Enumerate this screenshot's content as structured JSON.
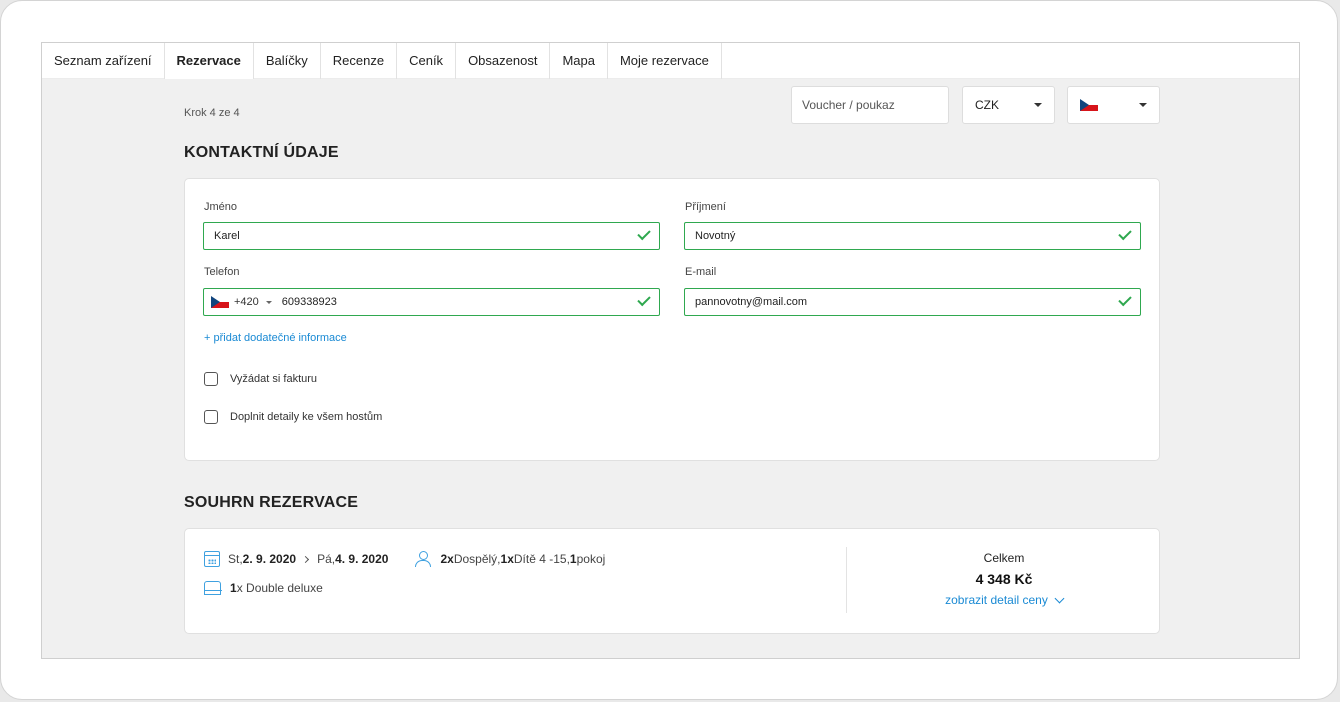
{
  "tabs": [
    {
      "label": "Seznam zařízení",
      "active": false
    },
    {
      "label": "Rezervace",
      "active": true
    },
    {
      "label": "Balíčky",
      "active": false
    },
    {
      "label": "Recenze",
      "active": false
    },
    {
      "label": "Ceník",
      "active": false
    },
    {
      "label": "Obsazenost",
      "active": false
    },
    {
      "label": "Mapa",
      "active": false
    },
    {
      "label": "Moje rezervace",
      "active": false
    }
  ],
  "step_text": "Krok 4 ze 4",
  "voucher": {
    "placeholder": "Voucher / poukaz"
  },
  "currency": {
    "selected": "CZK"
  },
  "language": {
    "flag": "cz-flag-icon"
  },
  "contact": {
    "title": "KONTAKTNÍ ÚDAJE",
    "first_name": {
      "label": "Jméno",
      "value": "Karel"
    },
    "last_name": {
      "label": "Příjmení",
      "value": "Novotný"
    },
    "phone": {
      "label": "Telefon",
      "prefix": "+420",
      "value": "609338923"
    },
    "email": {
      "label": "E-mail",
      "value": "pannovotny@mail.com"
    },
    "add_info_link": "+ přidat dodatečné informace",
    "invoice_checkbox": "Vyžádat si fakturu",
    "guests_checkbox": "Doplnit detaily ke všem hostům"
  },
  "summary": {
    "title": "SOUHRN REZERVACE",
    "from_day": "St, ",
    "from_date": "2. 9. 2020",
    "to_day": "Pá, ",
    "to_date": "4. 9. 2020",
    "adults_count": "2x",
    "adults_label": " Dospělý, ",
    "children_count": "1x",
    "children_label": " Dítě 4 -15, ",
    "rooms_count": "1",
    "rooms_label": " pokoj",
    "room_qty": "1",
    "room_name": " x Double deluxe",
    "total_label": "Celkem",
    "total_price": "4 348 Kč",
    "price_detail_link": "zobrazit detail ceny"
  },
  "colors": {
    "valid_green": "#2fa84f",
    "link_blue": "#1a8ad4",
    "icon_blue": "#3fa1e0"
  }
}
